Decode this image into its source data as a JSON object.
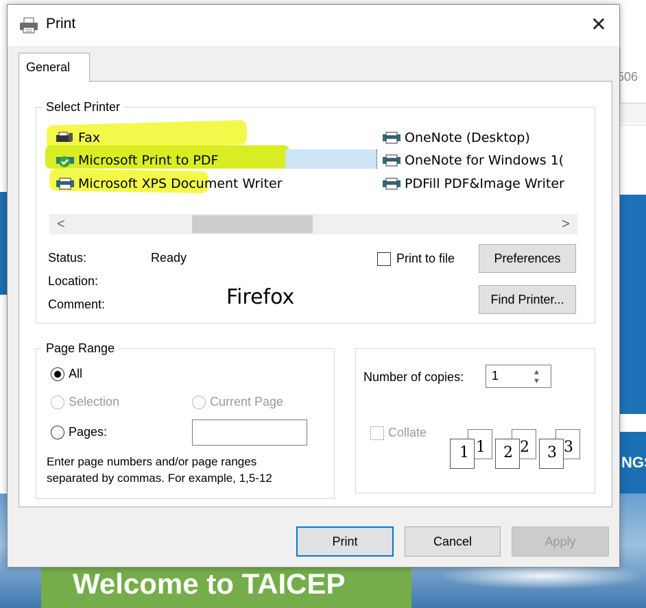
{
  "background": {
    "right_text": "506",
    "right_band_text": "NGS",
    "welcome_banner": "Welcome to TAICEP"
  },
  "dialog": {
    "title": "Print",
    "close_symbol": "✕",
    "tab": "General",
    "select_printer": {
      "legend": "Select Printer",
      "printers_left": [
        "Fax",
        "Microsoft Print to PDF",
        "Microsoft XPS Document Writer"
      ],
      "printers_right": [
        "OneNote (Desktop)",
        "OneNote for Windows 1(",
        "PDFill PDF&Image Writer"
      ],
      "selected": "Microsoft Print to PDF",
      "scroll_left": "<",
      "scroll_right": ">",
      "status_label": "Status:",
      "status_value": "Ready",
      "location_label": "Location:",
      "comment_label": "Comment:",
      "comment_annotation": "Firefox",
      "print_to_file": "Print to file",
      "preferences": "Preferences",
      "find_printer": "Find Printer..."
    },
    "page_range": {
      "legend": "Page Range",
      "all": "All",
      "selection": "Selection",
      "current_page": "Current Page",
      "pages": "Pages:",
      "pages_value": "",
      "help_line1": "Enter page numbers and/or page ranges",
      "help_line2": "separated by commas.  For example, 1,5-12"
    },
    "copies": {
      "label": "Number of copies:",
      "value": "1",
      "collate": "Collate",
      "page_numbers": [
        "1",
        "1",
        "2",
        "2",
        "3",
        "3"
      ]
    },
    "buttons": {
      "print": "Print",
      "cancel": "Cancel",
      "apply": "Apply"
    }
  },
  "colors": {
    "highlighter_yellow": "#f3f94a",
    "selection_blue": "#cce4f7",
    "accent": "#0078d7"
  }
}
